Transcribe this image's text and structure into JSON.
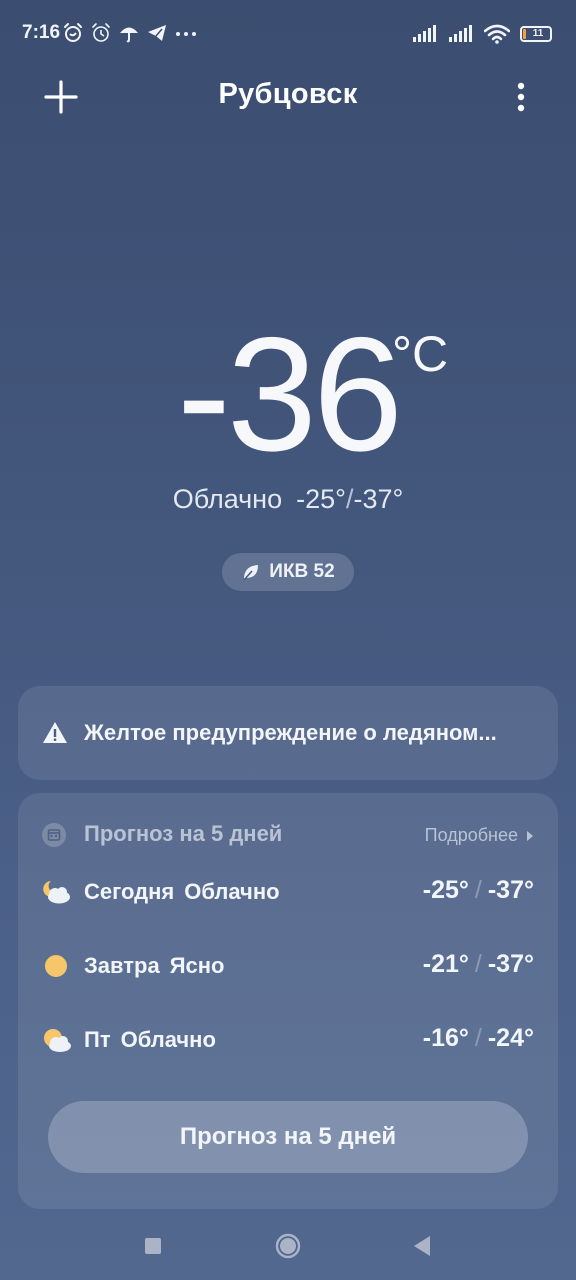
{
  "status_bar": {
    "time": "7:16",
    "battery_level": "11",
    "icons": [
      "alarm-icon",
      "alarm-outline-icon",
      "umbrella-icon",
      "telegram-icon",
      "more-dots-icon",
      "signal-icon",
      "signal-icon",
      "wifi-icon",
      "battery-icon"
    ]
  },
  "header": {
    "city": "Рубцовск",
    "add_icon": "plus-icon",
    "menu_icon": "more-vert-icon"
  },
  "current": {
    "temperature": "-36",
    "unit": "°C",
    "condition": "Облачно",
    "high": "-25°",
    "low": "-37°",
    "aqi_label": "ИКВ 52"
  },
  "warning": {
    "text": "Желтое предупреждение о ледяном..."
  },
  "forecast": {
    "title": "Прогноз на 5 дней",
    "more_label": "Подробнее",
    "days": [
      {
        "day": "Сегодня",
        "condition": "Облачно",
        "high": "-25°",
        "low": "-37°",
        "icon": "partly-cloudy-night-icon"
      },
      {
        "day": "Завтра",
        "condition": "Ясно",
        "high": "-21°",
        "low": "-37°",
        "icon": "sun-icon"
      },
      {
        "day": "Пт",
        "condition": "Облачно",
        "high": "-16°",
        "low": "-24°",
        "icon": "partly-cloudy-icon"
      }
    ],
    "button_label": "Прогноз на 5 дней"
  },
  "colors": {
    "background_top": "#3b4d70",
    "background_bottom": "#52688f",
    "sun": "#f7c66b",
    "text": "#f2f5f9",
    "muted": "#b9c3d4"
  }
}
